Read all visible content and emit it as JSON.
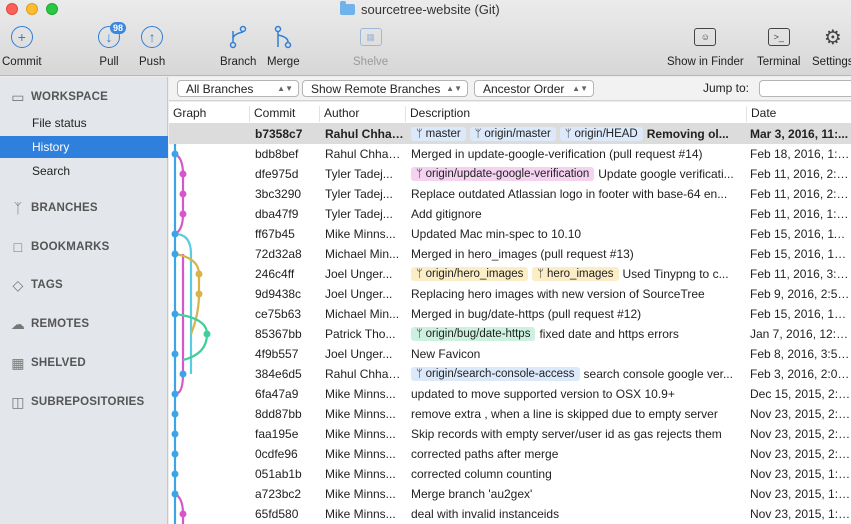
{
  "window": {
    "title": "sourcetree-website (Git)"
  },
  "toolbar": {
    "commit": "Commit",
    "pull": "Pull",
    "pull_badge": "98",
    "push": "Push",
    "branch": "Branch",
    "merge": "Merge",
    "shelve": "Shelve",
    "show_in_finder": "Show in Finder",
    "terminal": "Terminal",
    "settings": "Settings"
  },
  "sidebar": {
    "workspace": "WORKSPACE",
    "workspace_items": [
      "File status",
      "History",
      "Search"
    ],
    "selected": "History",
    "sections": [
      "BRANCHES",
      "BOOKMARKS",
      "TAGS",
      "REMOTES",
      "SHELVED",
      "SUBREPOSITORIES"
    ]
  },
  "filters": {
    "branches": "All Branches",
    "remote": "Show Remote Branches",
    "order": "Ancestor Order",
    "jump_to": "Jump to:"
  },
  "columns": [
    "Graph",
    "Commit",
    "Author",
    "Description",
    "Date"
  ],
  "colors": {
    "accent": "#2f7fdc",
    "blue": "#3ea4e8",
    "pink": "#d657c9",
    "yellow": "#d9b24a",
    "green": "#3fcf9a",
    "cyan": "#56cde0"
  },
  "commits": [
    {
      "hash": "b7358c7",
      "author": "Rahul Chhab...",
      "tags": [
        {
          "label": "master",
          "color": "blue"
        },
        {
          "label": "origin/master",
          "color": "blue"
        },
        {
          "label": "origin/HEAD",
          "color": "blue"
        }
      ],
      "desc": "Removing ol...",
      "date": "Mar 3, 2016, 11:..."
    },
    {
      "hash": "bdb8bef",
      "author": "Rahul Chhab...",
      "tags": [],
      "desc": "Merged in update-google-verification (pull request #14)",
      "date": "Feb 18, 2016, 1:3..."
    },
    {
      "hash": "dfe975d",
      "author": "Tyler Tadej...",
      "tags": [
        {
          "label": "origin/update-google-verification",
          "color": "pink"
        }
      ],
      "desc": "Update google verificati...",
      "date": "Feb 11, 2016, 2:2..."
    },
    {
      "hash": "3bc3290",
      "author": "Tyler Tadej...",
      "tags": [],
      "desc": "Replace outdated Atlassian logo in footer with base-64 en...",
      "date": "Feb 11, 2016, 2:1..."
    },
    {
      "hash": "dba47f9",
      "author": "Tyler Tadej...",
      "tags": [],
      "desc": "Add gitignore",
      "date": "Feb 11, 2016, 1:3..."
    },
    {
      "hash": "ff67b45",
      "author": "Mike Minns...",
      "tags": [],
      "desc": "Updated Mac min-spec to 10.10",
      "date": "Feb 15, 2016, 11:..."
    },
    {
      "hash": "72d32a8",
      "author": "Michael Min...",
      "tags": [],
      "desc": "Merged in hero_images (pull request #13)",
      "date": "Feb 15, 2016, 10:..."
    },
    {
      "hash": "246c4ff",
      "author": "Joel Unger...",
      "tags": [
        {
          "label": "origin/hero_images",
          "color": "yellow"
        },
        {
          "label": "hero_images",
          "color": "yellow"
        }
      ],
      "desc": "Used Tinypng to c...",
      "date": "Feb 11, 2016, 3:3..."
    },
    {
      "hash": "9d9438c",
      "author": "Joel Unger...",
      "tags": [],
      "desc": "Replacing hero images with new version of SourceTree",
      "date": "Feb 9, 2016, 2:59..."
    },
    {
      "hash": "ce75b63",
      "author": "Michael Min...",
      "tags": [],
      "desc": "Merged in bug/date-https (pull request #12)",
      "date": "Feb 15, 2016, 10:..."
    },
    {
      "hash": "85367bb",
      "author": "Patrick Tho...",
      "tags": [
        {
          "label": "origin/bug/date-https",
          "color": "green"
        }
      ],
      "desc": "fixed date and https errors",
      "date": "Jan 7, 2016, 12:2..."
    },
    {
      "hash": "4f9b557",
      "author": "Joel Unger...",
      "tags": [],
      "desc": "New Favicon",
      "date": "Feb 8, 2016, 3:55..."
    },
    {
      "hash": "384e6d5",
      "author": "Rahul Chhab...",
      "tags": [
        {
          "label": "origin/search-console-access",
          "color": "blue"
        }
      ],
      "desc": "search console google ver...",
      "date": "Feb 3, 2016, 2:09..."
    },
    {
      "hash": "6fa47a9",
      "author": "Mike Minns...",
      "tags": [],
      "desc": "updated to move supported version to OSX 10.9+",
      "date": "Dec 15, 2015, 2:0..."
    },
    {
      "hash": "8dd87bb",
      "author": "Mike Minns...",
      "tags": [],
      "desc": "remove extra , when a line is skipped due to empty server",
      "date": "Nov 23, 2015, 2:2..."
    },
    {
      "hash": "faa195e",
      "author": "Mike Minns...",
      "tags": [],
      "desc": "Skip records with empty server/user id as gas rejects them",
      "date": "Nov 23, 2015, 2:1..."
    },
    {
      "hash": "0cdfe96",
      "author": "Mike Minns...",
      "tags": [],
      "desc": "corrected paths after merge",
      "date": "Nov 23, 2015, 2:0..."
    },
    {
      "hash": "051ab1b",
      "author": "Mike Minns...",
      "tags": [],
      "desc": " corrected column counting",
      "date": "Nov 23, 2015, 1:5..."
    },
    {
      "hash": "a723bc2",
      "author": "Mike Minns...",
      "tags": [],
      "desc": "Merge branch 'au2gex'",
      "date": "Nov 23, 2015, 1:5..."
    },
    {
      "hash": "65fd580",
      "author": "Mike Minns...",
      "tags": [],
      "desc": "deal with invalid instanceids",
      "date": "Nov 23, 2015, 1:5..."
    }
  ]
}
